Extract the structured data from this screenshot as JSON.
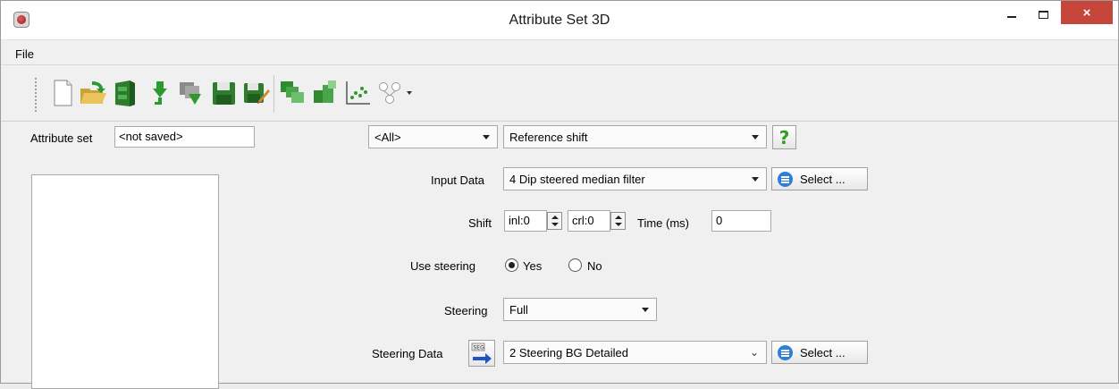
{
  "window": {
    "title": "Attribute Set 3D",
    "close_label": "×"
  },
  "menu": {
    "file": "File"
  },
  "toolbar": {
    "icons": [
      "new-icon",
      "open-icon",
      "save-to-database-icon",
      "import-icon",
      "merge-icon",
      "save-icon",
      "save-as-icon",
      "calculate-icon",
      "add-attributes-icon",
      "crossplot-icon",
      "neural-network-icon"
    ]
  },
  "attribute_set": {
    "label": "Attribute set",
    "value": "<not saved>"
  },
  "filter_combo": {
    "value": "<All>"
  },
  "attribute_type_combo": {
    "value": "Reference shift"
  },
  "help": {
    "glyph": "?"
  },
  "input_data": {
    "label": "Input Data",
    "value": "4 Dip steered median filter",
    "select_label": "Select ..."
  },
  "shift": {
    "label": "Shift",
    "inl": "inl:0",
    "crl": "crl:0",
    "time_label": "Time (ms)",
    "time_value": "0"
  },
  "use_steering": {
    "label": "Use steering",
    "yes": "Yes",
    "no": "No",
    "selected": "Yes"
  },
  "steering": {
    "label": "Steering",
    "value": "Full"
  },
  "steering_data": {
    "label": "Steering Data",
    "icon_text": "SEG",
    "value": "2 Steering BG Detailed",
    "select_label": "Select ..."
  },
  "colors": {
    "close_button": "#c7463c",
    "select_icon": "#2f7fd8",
    "help_glyph": "#2c9e1a"
  }
}
